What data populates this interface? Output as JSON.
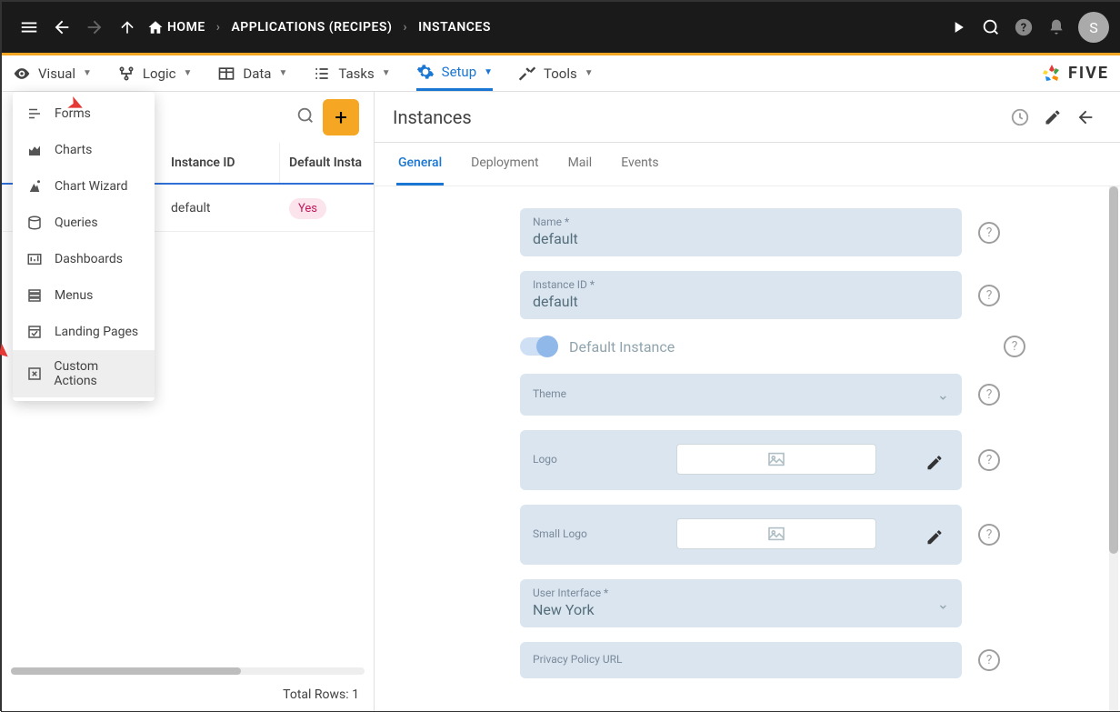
{
  "topbar": {
    "home": "HOME",
    "crumb1": "APPLICATIONS (RECIPES)",
    "crumb2": "INSTANCES",
    "avatar_letter": "S"
  },
  "menubar": {
    "visual": "Visual",
    "logic": "Logic",
    "data": "Data",
    "tasks": "Tasks",
    "setup": "Setup",
    "tools": "Tools",
    "brand": "FIVE"
  },
  "dropdown": {
    "items": [
      {
        "label": "Forms"
      },
      {
        "label": "Charts"
      },
      {
        "label": "Chart Wizard"
      },
      {
        "label": "Queries"
      },
      {
        "label": "Dashboards"
      },
      {
        "label": "Menus"
      },
      {
        "label": "Landing Pages"
      },
      {
        "label": "Custom Actions"
      }
    ]
  },
  "left": {
    "col_id": "Instance ID",
    "col_def": "Default Insta",
    "row_id": "default",
    "row_def": "Yes",
    "footer": "Total Rows: 1"
  },
  "right": {
    "title": "Instances",
    "tabs": {
      "general": "General",
      "deployment": "Deployment",
      "mail": "Mail",
      "events": "Events"
    },
    "fields": {
      "name_label": "Name *",
      "name_value": "default",
      "instid_label": "Instance ID *",
      "instid_value": "default",
      "default_instance": "Default Instance",
      "theme_label": "Theme",
      "logo_label": "Logo",
      "smalllogo_label": "Small Logo",
      "ui_label": "User Interface *",
      "ui_value": "New York",
      "privacy_label": "Privacy Policy URL"
    }
  }
}
